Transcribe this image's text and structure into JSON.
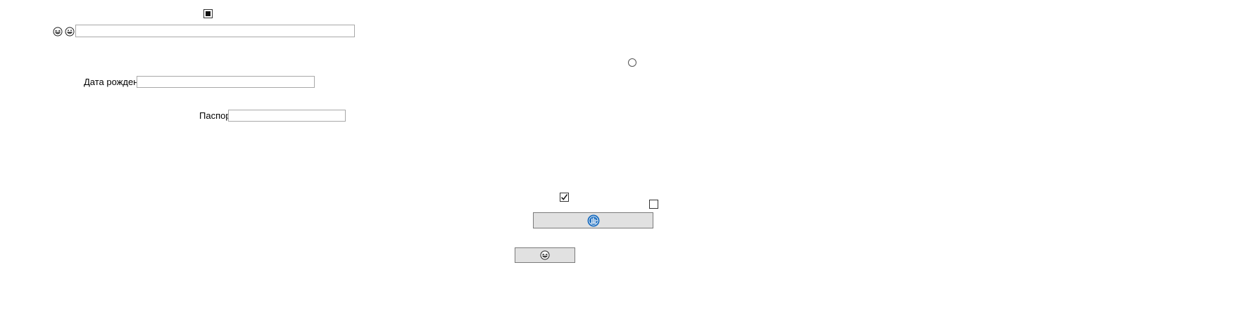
{
  "form": {
    "birth_date_label": "Дата рождения",
    "birth_date_value": "",
    "passport_label": "Паспорт",
    "passport_value": "",
    "top_field_value": ""
  },
  "controls": {
    "top_checkbox_state": "indeterminate",
    "radio_checked": false,
    "checkbox_a_checked": true,
    "checkbox_b_checked": false
  },
  "icons": {
    "face_1": "grinning-squint-face-icon",
    "face_2": "grinning-face-icon",
    "wide_button_icon": "blue-badge-icon",
    "small_button_icon": "grinning-squint-face-icon"
  },
  "colors": {
    "field_border": "#a8a8a8",
    "button_bg": "#e1e1e1",
    "button_border": "#7a7a7a",
    "badge_blue": "#1e6fc0"
  }
}
